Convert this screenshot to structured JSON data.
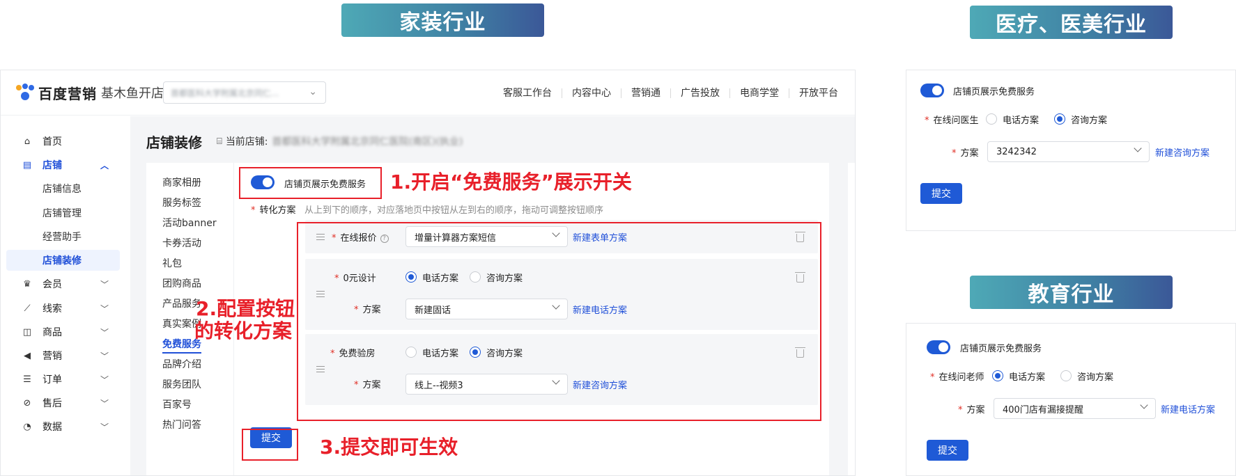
{
  "banners": {
    "home": "家装行业",
    "medical": "医疗、医美行业",
    "education": "教育行业"
  },
  "app": {
    "brand": "百度营销",
    "product": "基木鱼开店",
    "store_select_value": "首都医科大学附属北京同仁...",
    "top_nav": [
      "客服工作台",
      "内容中心",
      "营销通",
      "广告投放",
      "电商学堂",
      "开放平台"
    ],
    "sidebar": [
      {
        "label": "首页",
        "icon": "home-icon"
      },
      {
        "label": "店铺",
        "icon": "store-icon",
        "expanded": true
      },
      {
        "label": "会员",
        "icon": "crown-icon"
      },
      {
        "label": "线索",
        "icon": "chart-icon"
      },
      {
        "label": "商品",
        "icon": "bag-icon"
      },
      {
        "label": "营销",
        "icon": "megaphone-icon"
      },
      {
        "label": "订单",
        "icon": "order-icon"
      },
      {
        "label": "售后",
        "icon": "service-icon"
      },
      {
        "label": "数据",
        "icon": "pie-icon"
      }
    ],
    "sidebar_sub": [
      "店铺信息",
      "店铺管理",
      "经营助手",
      "店铺装修"
    ],
    "page_title": "店铺装修",
    "current_store_label": "当前店铺:",
    "current_store_value": "首都医科大学附属北京同仁医院(南区)(执业)",
    "subnav": [
      "商家相册",
      "服务标签",
      "活动banner",
      "卡券活动",
      "礼包",
      "团购商品",
      "产品服务",
      "真实案例",
      "免费服务",
      "品牌介绍",
      "服务团队",
      "百家号",
      "热门问答"
    ],
    "toggle_label": "店铺页展示免费服务",
    "conversion_label": "转化方案",
    "conversion_hint": "从上到下的顺序，对应落地页中按钮从左到右的顺序，拖动可调整按钮顺序",
    "groups": {
      "g1": {
        "label": "在线报价",
        "select": "增量计算器方案短信",
        "link": "新建表单方案"
      },
      "g2": {
        "label": "0元设计",
        "radio_a": "电话方案",
        "radio_b": "咨询方案",
        "plan_label": "方案",
        "select": "新建固话",
        "link": "新建电话方案"
      },
      "g3": {
        "label": "免费验房",
        "radio_a": "电话方案",
        "radio_b": "咨询方案",
        "plan_label": "方案",
        "select": "线上--视频3",
        "link": "新建咨询方案"
      }
    },
    "submit": "提交"
  },
  "annotations": {
    "step1": "1.开启“免费服务”展示开关",
    "step2_line1": "2.配置按钮",
    "step2_line2": "的转化方案",
    "step3": "3.提交即可生效"
  },
  "medical_card": {
    "toggle_label": "店铺页展示免费服务",
    "field_label": "在线问医生",
    "radio_a": "电话方案",
    "radio_b": "咨询方案",
    "plan_label": "方案",
    "select": "3242342",
    "link": "新建咨询方案",
    "submit": "提交"
  },
  "education_card": {
    "toggle_label": "店铺页展示免费服务",
    "field_label": "在线问老师",
    "radio_a": "电话方案",
    "radio_b": "咨询方案",
    "plan_label": "方案",
    "select": "400门店有漏接提醒",
    "link": "新建电话方案",
    "submit": "提交"
  },
  "colors": {
    "primary": "#1f5ad6",
    "link": "#1f4fd8",
    "annotation": "#e8202a",
    "banner_start": "#4ea9b6",
    "banner_end": "#3b5898"
  }
}
